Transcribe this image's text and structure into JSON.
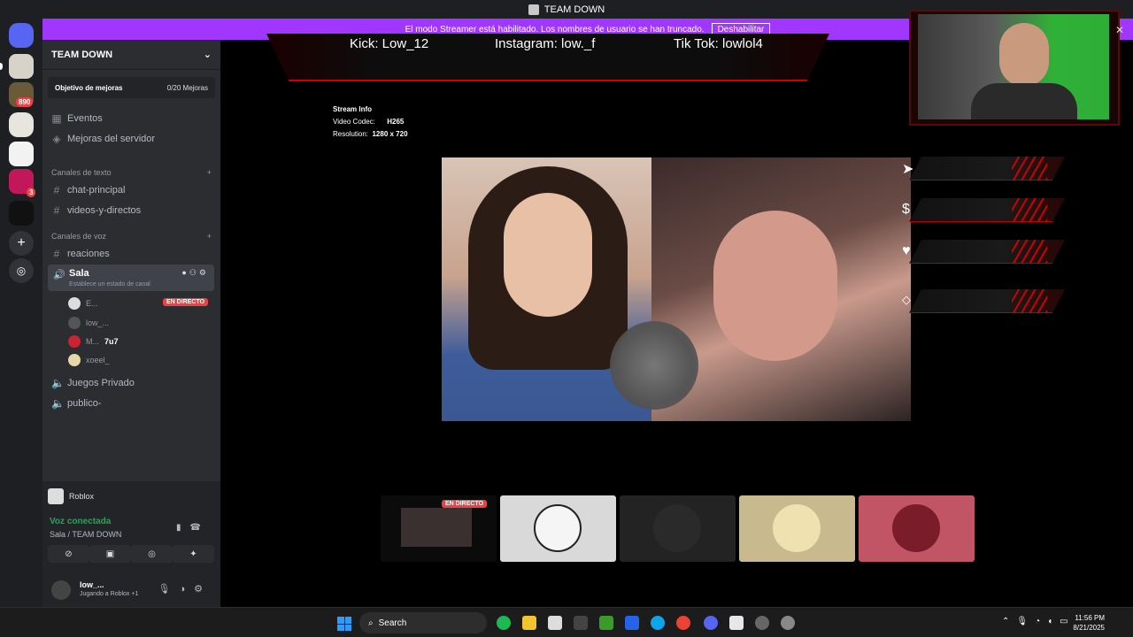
{
  "window": {
    "title": "TEAM DOWN"
  },
  "banner": {
    "text": "El modo Streamer está habilitado. Los nombres de usuario se han truncado.",
    "button": "Deshabilitar"
  },
  "rail": {
    "badge_890": "890",
    "badge_3": "3"
  },
  "sidebar": {
    "server_name": "TEAM DOWN",
    "boost_label": "Objetivo de mejoras",
    "boost_count": "0/20 Mejoras",
    "events": "Eventos",
    "server_boosts": "Mejoras del servidor",
    "text_category": "Canales de texto",
    "text_channels": [
      "chat-principal",
      "videos-y-directos"
    ],
    "voice_category": "Canales de voz",
    "reactions_channel": "reaciones",
    "voice_channel": {
      "name": "Sala",
      "status": "Establece un estado de canal",
      "users": [
        {
          "name": "E...",
          "live": "EN DIRECTO"
        },
        {
          "name": "low_..."
        },
        {
          "name": "M...",
          "extra": "7u7"
        },
        {
          "name": "xoeel_"
        }
      ]
    },
    "other_voice": [
      "Juegos Privado",
      "publico-"
    ]
  },
  "activity": {
    "game": "Roblox",
    "voice_connected": "Voz conectada",
    "voice_location": "Sala / TEAM DOWN"
  },
  "userbar": {
    "name": "low_...",
    "status": "Jugando a Roblox +1"
  },
  "stream": {
    "overlay": {
      "kick": "Kick: Low_12",
      "instagram": "Instagram: low._f",
      "tiktok": "Tik Tok: lowlol4"
    },
    "info_title": "Stream Info",
    "codec_label": "Video Codec:",
    "codec_value": "H265",
    "res_label": "Resolution:",
    "res_value": "1280 x 720",
    "side_icons": [
      "cursor-icon",
      "dollar-icon",
      "heart-icon",
      "diamond-icon"
    ],
    "thumb_live": "EN DIRECTO"
  },
  "taskbar": {
    "search": "Search",
    "time": "11:56 PM",
    "date": "8/21/2025"
  }
}
